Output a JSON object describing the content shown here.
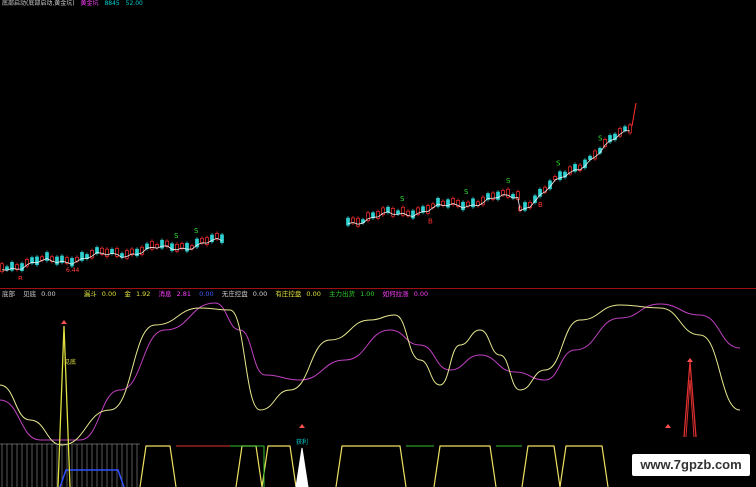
{
  "header": {
    "title": "底部启动(底部启动,黄金坑)",
    "items": [
      {
        "label": "黄金坑",
        "color": "#ff40ff"
      },
      {
        "label": "8845",
        "color": "#00d0d0"
      },
      {
        "label": "52.00",
        "color": "#00d0d0"
      }
    ]
  },
  "price_panel": {
    "low_label": "6.44",
    "buy_mark": "B",
    "sell_mark": "S"
  },
  "indicator_legend": [
    {
      "label": "底部",
      "value": "",
      "color": "#d0d0d0"
    },
    {
      "label": "见底",
      "value": "0.00",
      "color": "#d0d0d0"
    },
    {
      "label": "漏斗",
      "value": "",
      "color": "#e0e040"
    },
    {
      "label": "",
      "value": "0.00",
      "color": "#e0e040"
    },
    {
      "label": "金",
      "value": "1.92",
      "color": "#e0e040"
    },
    {
      "label": "消息",
      "value": "2.81",
      "color": "#ff40ff"
    },
    {
      "label": "",
      "value": "0.00",
      "color": "#4060ff"
    },
    {
      "label": "无庄控盘",
      "value": "0.00",
      "color": "#d0d0d0"
    },
    {
      "label": "有庄控盘",
      "value": "0.00",
      "color": "#e0e040"
    },
    {
      "label": "主力出货",
      "value": "1.00",
      "color": "#30d030"
    },
    {
      "label": "如何拉涨",
      "value": "0.00",
      "color": "#ff40ff"
    }
  ],
  "indicator_panel": {
    "bottom_label": "见底",
    "profit_label": "获利"
  },
  "watermark": "www.7gpzb.com",
  "colors": {
    "background": "#000000",
    "up_candle": "#ff3030",
    "down_candle": "#30d0d0",
    "ma_line": "#f0f0f0",
    "oscillator_fast": "#e8e890",
    "oscillator_slow": "#c040c0",
    "divider": "#a01010"
  }
}
